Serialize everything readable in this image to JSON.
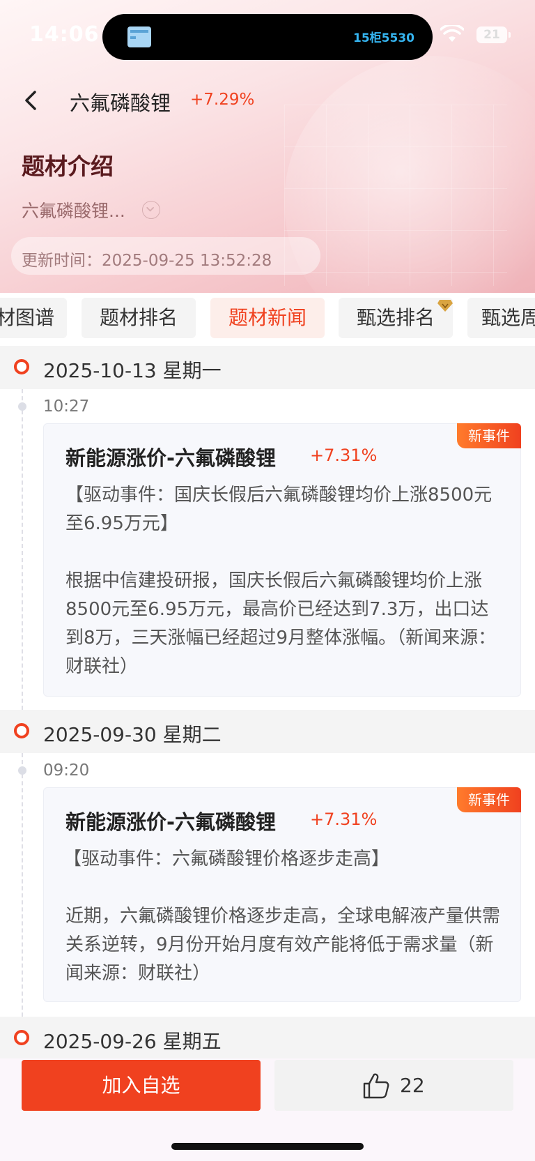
{
  "status_bar": {
    "time": "14:06",
    "island_text": "15柜5530",
    "battery": "21"
  },
  "nav": {
    "title": "六氟磷酸锂",
    "change": "+7.29%"
  },
  "intro": {
    "section_title": "题材介绍",
    "summary": "六氟磷酸锂...",
    "update_time": "更新时间：2025-09-25 13:52:28"
  },
  "tabs": [
    {
      "label": "题材图谱",
      "active": false
    },
    {
      "label": "题材排名",
      "active": false
    },
    {
      "label": "题材新闻",
      "active": true
    },
    {
      "label": "甄选排名",
      "active": false
    },
    {
      "label": "甄选周",
      "active": false
    }
  ],
  "timeline": [
    {
      "date": "2025-10-13 星期一",
      "time": "10:27",
      "badge": "新事件",
      "title": "新能源涨价-六氟磷酸锂",
      "change": "+7.31%",
      "event": "【驱动事件：国庆长假后六氟磷酸锂均价上涨8500元至6.95万元】",
      "content": "根据中信建投研报，国庆长假后六氟磷酸锂均价上涨8500元至6.95万元，最高价已经达到7.3万，出口达到8万，三天涨幅已经超过9月整体涨幅。（新闻来源：财联社）"
    },
    {
      "date": "2025-09-30 星期二",
      "time": "09:20",
      "badge": "新事件",
      "title": "新能源涨价-六氟磷酸锂",
      "change": "+7.31%",
      "event": "【驱动事件：六氟磷酸锂价格逐步走高】",
      "content": "近期，六氟磷酸锂价格逐步走高，全球电解液产量供需关系逆转，9月份开始月度有效产能将低于需求量（新闻来源：财联社）"
    },
    {
      "date": "2025-09-26 星期五"
    }
  ],
  "bottom": {
    "add_label": "加入自选",
    "like_count": "22"
  },
  "colors": {
    "accent": "#f0411f",
    "tab_active_bg": "#fdeeea",
    "card_bg": "#f7f8fc"
  }
}
